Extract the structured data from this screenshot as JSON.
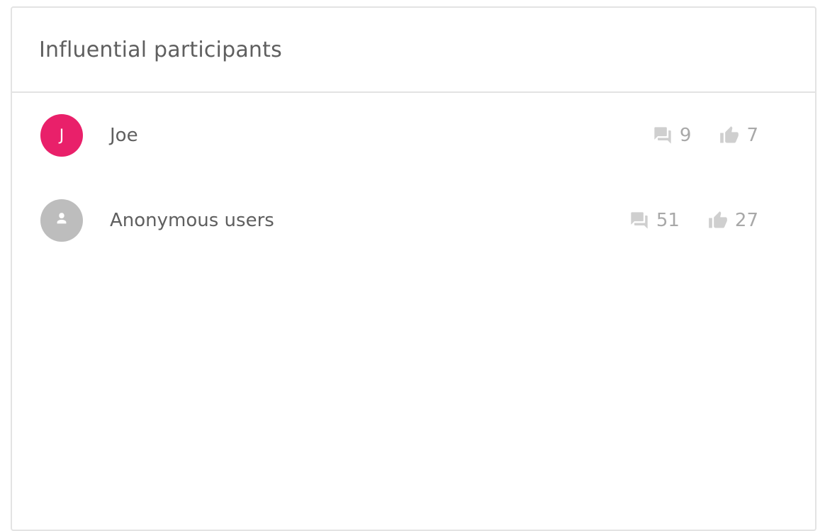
{
  "panel": {
    "title": "Influential participants"
  },
  "participants": [
    {
      "avatar_letter": "J",
      "avatar_color": "#e9206a",
      "name": "Joe",
      "comments": "9",
      "likes": "7"
    },
    {
      "avatar_icon": "person-icon",
      "avatar_color": "#bdbdbd",
      "name": "Anonymous users",
      "comments": "51",
      "likes": "27"
    }
  ],
  "icons": {
    "comments": "forum-icon",
    "likes": "thumbs-up-icon"
  },
  "colors": {
    "text": "#5f5f5f",
    "muted": "#a8a8a8",
    "border": "#e3e3e3"
  }
}
